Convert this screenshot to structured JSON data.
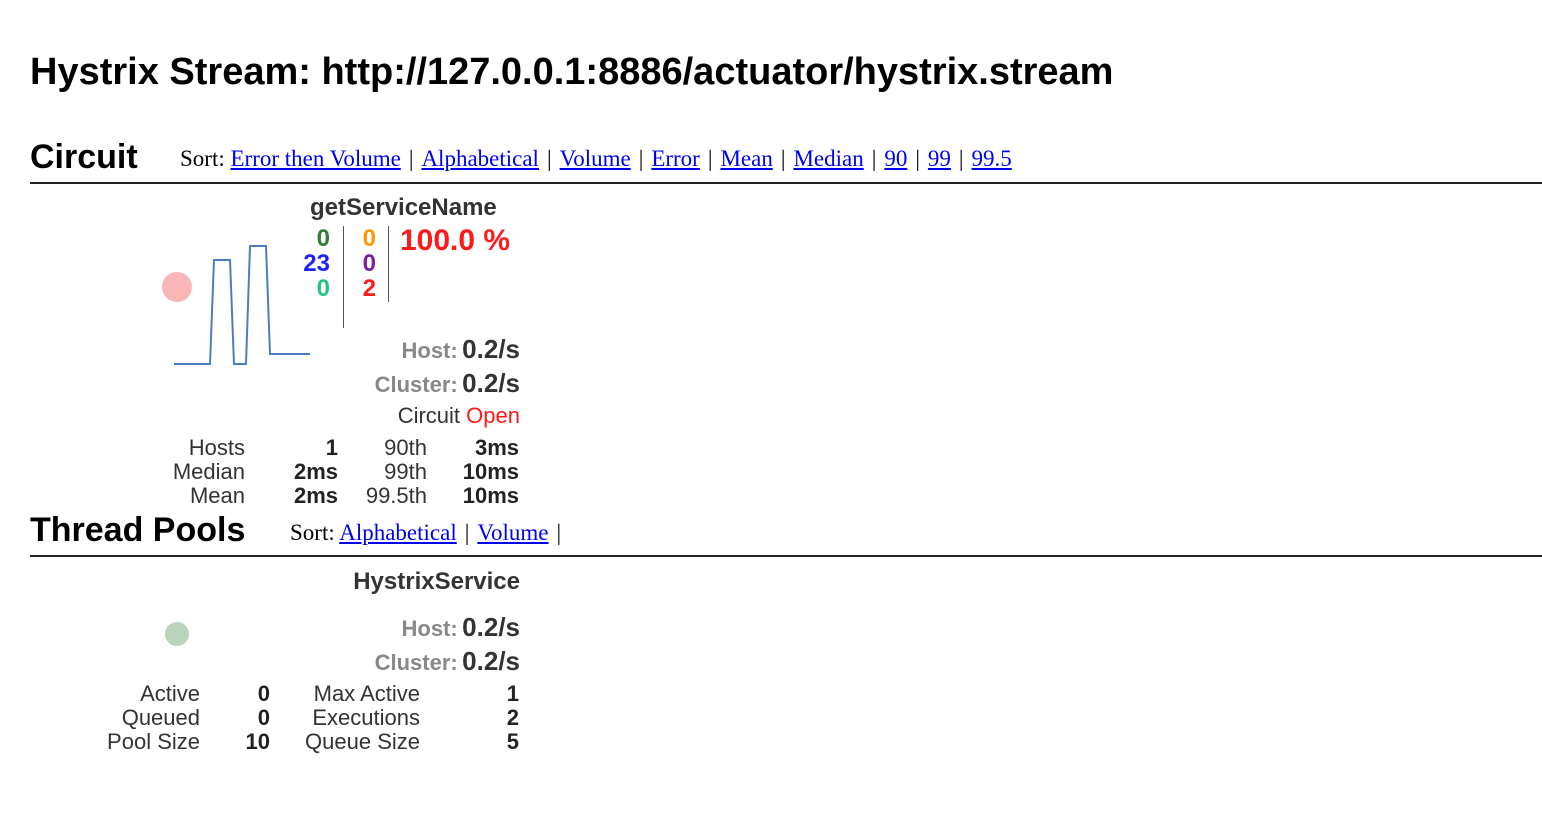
{
  "header": {
    "title": "Hystrix Stream: http://127.0.0.1:8886/actuator/hystrix.stream"
  },
  "circuit_section": {
    "title": "Circuit",
    "sort_label": "Sort:",
    "sort_options": [
      "Error then Volume",
      "Alphabetical",
      "Volume",
      "Error",
      "Mean",
      "Median",
      "90",
      "99",
      "99.5"
    ]
  },
  "circuit": {
    "name": "getServiceName",
    "counts": {
      "success": "0",
      "short_circuited": "23",
      "bad_request": "0",
      "timeout": "0",
      "rejected": "0",
      "failure": "2"
    },
    "error_pct": "100.0 %",
    "host_label": "Host:",
    "host_rate": "0.2/s",
    "cluster_label": "Cluster:",
    "cluster_rate": "0.2/s",
    "status_label": "Circuit",
    "status_value": "Open",
    "stats": {
      "hosts_label": "Hosts",
      "hosts_value": "1",
      "median_label": "Median",
      "median_value": "2ms",
      "mean_label": "Mean",
      "mean_value": "2ms",
      "p90_label": "90th",
      "p90_value": "3ms",
      "p99_label": "99th",
      "p99_value": "10ms",
      "p995_label": "99.5th",
      "p995_value": "10ms"
    },
    "colors": {
      "success": "#2e7d32",
      "short_circuited": "#1e1eff",
      "bad_request": "#26c281",
      "timeout": "#ff9800",
      "rejected": "#7b1fa2",
      "failure": "#ff1a1a",
      "error_pct": "#ff1a1a",
      "circle": "#f8b6b6",
      "sparkline": "#4a7fbf"
    }
  },
  "threadpool_section": {
    "title": "Thread Pools",
    "sort_label": "Sort:",
    "sort_options": [
      "Alphabetical",
      "Volume"
    ]
  },
  "threadpool": {
    "name": "HystrixService",
    "host_label": "Host:",
    "host_rate": "0.2/s",
    "cluster_label": "Cluster:",
    "cluster_rate": "0.2/s",
    "stats": {
      "active_label": "Active",
      "active_value": "0",
      "queued_label": "Queued",
      "queued_value": "0",
      "pool_size_label": "Pool Size",
      "pool_size_value": "10",
      "max_active_label": "Max Active",
      "max_active_value": "1",
      "executions_label": "Executions",
      "executions_value": "2",
      "queue_size_label": "Queue Size",
      "queue_size_value": "5"
    },
    "colors": {
      "circle": "#b9d3bc"
    }
  }
}
